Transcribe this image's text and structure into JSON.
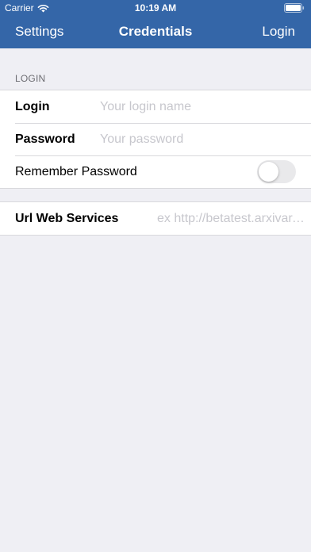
{
  "status_bar": {
    "carrier": "Carrier",
    "time": "10:19 AM",
    "wifi_icon": "wifi-icon",
    "battery_icon": "battery-icon"
  },
  "nav": {
    "left_button": "Settings",
    "title": "Credentials",
    "right_button": "Login"
  },
  "login_section": {
    "header": "LOGIN",
    "login": {
      "label": "Login",
      "placeholder": "Your login name",
      "value": ""
    },
    "password": {
      "label": "Password",
      "placeholder": "Your password",
      "value": ""
    },
    "remember": {
      "label": "Remember Password",
      "enabled": false
    }
  },
  "url_section": {
    "label": "Url Web Services",
    "placeholder": "ex http://betatest.arxivar.it/ARXivarWebServices",
    "value": ""
  },
  "colors": {
    "nav_background": "#3466a8",
    "page_background": "#efeff4",
    "placeholder": "#c7c7cd",
    "toggle_off": "#e9e9eb"
  }
}
